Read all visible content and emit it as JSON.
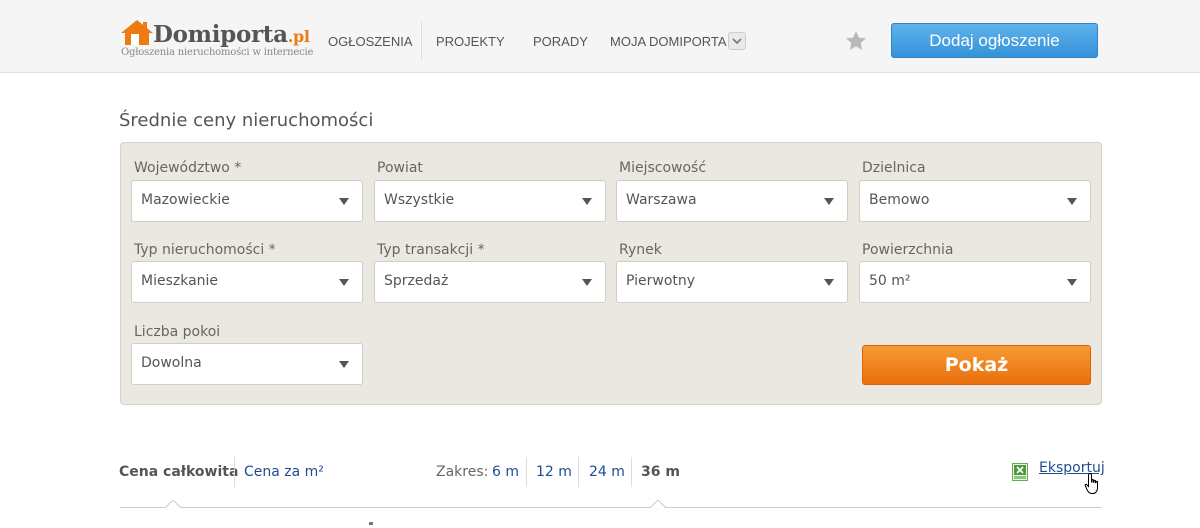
{
  "header": {
    "logo": {
      "name": "Domiporta",
      "tld": ".pl",
      "tagline": "Ogłoszenia nieruchomości w internecie"
    },
    "nav": [
      "OGŁOSZENIA",
      "PROJEKTY",
      "PORADY",
      "MOJA DOMIPORTA"
    ],
    "add_button": "Dodaj ogłoszenie",
    "icons": {
      "dropdown": "chevron-down-icon",
      "favorites": "star-icon"
    }
  },
  "page": {
    "title": "Średnie ceny nieruchomości"
  },
  "filters": {
    "wojewodztwo": {
      "label": "Województwo *",
      "value": "Mazowieckie"
    },
    "powiat": {
      "label": "Powiat",
      "value": "Wszystkie"
    },
    "miejscowosc": {
      "label": "Miejscowość",
      "value": "Warszawa"
    },
    "dzielnica": {
      "label": "Dzielnica",
      "value": "Bemowo"
    },
    "typ_nieruchomosci": {
      "label": "Typ nieruchomości *",
      "value": "Mieszkanie"
    },
    "typ_transakcji": {
      "label": "Typ transakcji *",
      "value": "Sprzedaż"
    },
    "rynek": {
      "label": "Rynek",
      "value": "Pierwotny"
    },
    "powierzchnia": {
      "label": "Powierzchnia",
      "value": "50 m²"
    },
    "liczba_pokoi": {
      "label": "Liczba pokoi",
      "value": "Dowolna"
    },
    "show_button": "Pokaż"
  },
  "results": {
    "tabs": [
      "Cena całkowita",
      "Cena za m²"
    ],
    "active_tab": "Cena całkowita",
    "range_label": "Zakres:",
    "range_options": [
      "6 m",
      "12 m",
      "24 m",
      "36 m"
    ],
    "active_range": "36 m",
    "export_label": "Eksportuj",
    "export_icon": "excel-icon"
  },
  "colors": {
    "accent_blue": "#3592d9",
    "accent_orange": "#ee7a14",
    "link": "#1f4d8f",
    "panel_bg": "#eae8e0"
  }
}
